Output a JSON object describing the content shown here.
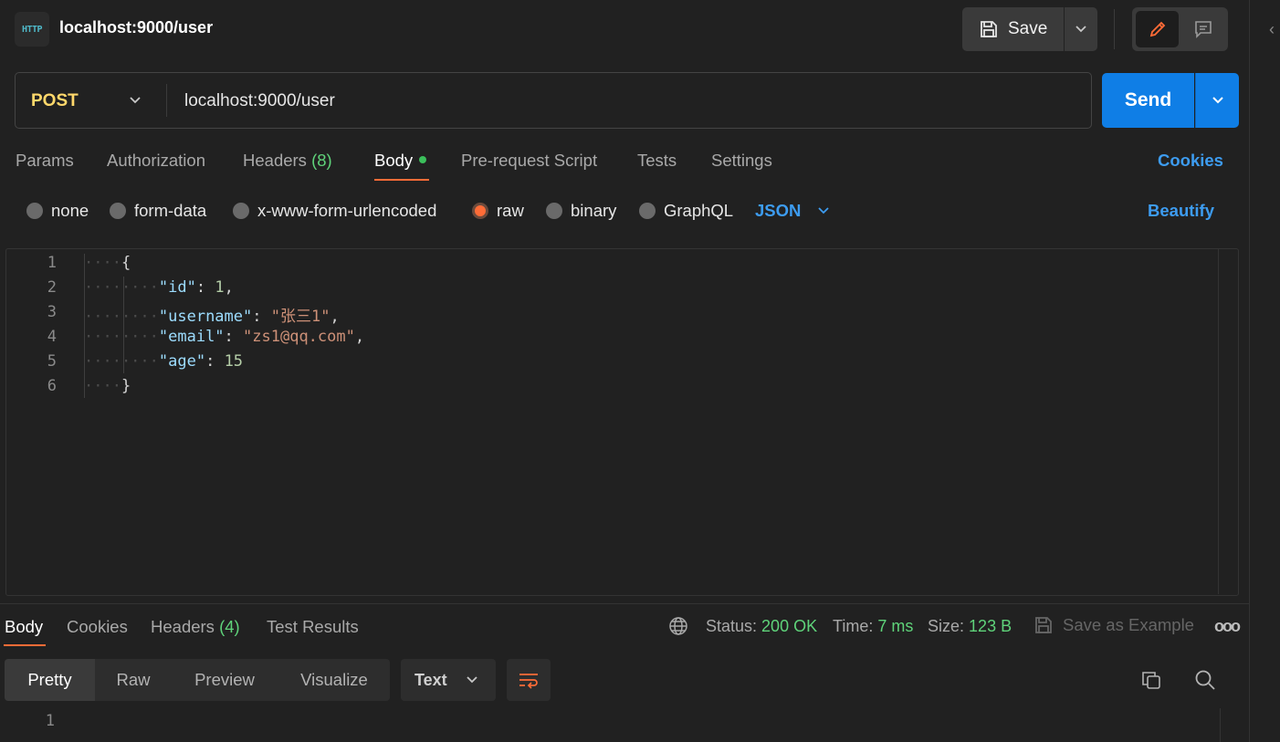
{
  "header": {
    "icon_label": "HTTP",
    "title": "localhost:9000/user",
    "save_label": "Save"
  },
  "request": {
    "method": "POST",
    "url": "localhost:9000/user",
    "send_label": "Send"
  },
  "request_tabs": {
    "params": "Params",
    "authorization": "Authorization",
    "headers": "Headers",
    "headers_count": "(8)",
    "body": "Body",
    "pre_request": "Pre-request Script",
    "tests": "Tests",
    "settings": "Settings",
    "cookies": "Cookies"
  },
  "body_modes": {
    "none": "none",
    "form_data": "form-data",
    "urlencoded": "x-www-form-urlencoded",
    "raw": "raw",
    "binary": "binary",
    "graphql": "GraphQL",
    "selected": "raw",
    "format": "JSON",
    "beautify": "Beautify"
  },
  "editor": {
    "line_numbers": [
      "1",
      "2",
      "3",
      "4",
      "5",
      "6"
    ],
    "open_brace": "{",
    "close_brace": "}",
    "fields": [
      {
        "key": "\"id\"",
        "sep": ": ",
        "value": "1",
        "trail": ",",
        "type": "number"
      },
      {
        "key": "\"username\"",
        "sep": ": ",
        "value": "\"张三1\"",
        "trail": ",",
        "type": "string"
      },
      {
        "key": "\"email\"",
        "sep": ": ",
        "value": "\"zs1@qq.com\"",
        "trail": ",",
        "type": "string"
      },
      {
        "key": "\"age\"",
        "sep": ": ",
        "value": "15",
        "trail": "",
        "type": "number"
      }
    ]
  },
  "response": {
    "tabs": {
      "body": "Body",
      "cookies": "Cookies",
      "headers": "Headers",
      "headers_count": "(4)",
      "test_results": "Test Results"
    },
    "status_label": "Status:",
    "status_value": "200 OK",
    "time_label": "Time:",
    "time_value": "7 ms",
    "size_label": "Size:",
    "size_value": "123 B",
    "save_example": "Save as Example",
    "more": "ooo",
    "views": {
      "pretty": "Pretty",
      "raw": "Raw",
      "preview": "Preview",
      "visualize": "Visualize"
    },
    "text_format": "Text",
    "line_numbers": [
      "1"
    ]
  },
  "colors": {
    "accent_orange": "#ff6c37",
    "send_blue": "#0f7ee6",
    "link_blue": "#3d9cf0",
    "method_yellow": "#ffd86b",
    "success_green": "#5fd37a"
  },
  "icons": [
    "http-icon",
    "save-icon",
    "chevron-down-icon",
    "pencil-icon",
    "comment-icon",
    "globe-icon",
    "copy-icon",
    "search-icon",
    "wrap-icon"
  ]
}
